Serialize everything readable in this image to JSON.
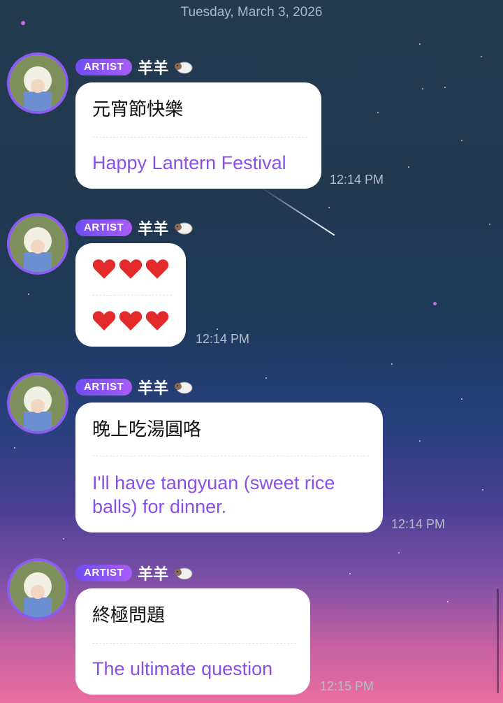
{
  "chat": {
    "date_header": "Tuesday, March 3, 2026"
  },
  "colors": {
    "badge_gradient_start": "#6f4cf1",
    "badge_gradient_end": "#a85cf6",
    "translation_text": "#8a50e6",
    "avatar_ring": "#8a5cf0"
  },
  "messages": [
    {
      "role_badge": "ARTIST",
      "sender_name": "羊羊",
      "sender_icon": "sheep-icon",
      "original_text": "元宵節快樂",
      "translated_text": "Happy Lantern Festival",
      "time": "12:14 PM"
    },
    {
      "role_badge": "ARTIST",
      "sender_name": "羊羊",
      "sender_icon": "sheep-icon",
      "original_icons": [
        "heart-icon",
        "heart-icon",
        "heart-icon"
      ],
      "translated_icons": [
        "heart-icon",
        "heart-icon",
        "heart-icon"
      ],
      "time": "12:14 PM"
    },
    {
      "role_badge": "ARTIST",
      "sender_name": "羊羊",
      "sender_icon": "sheep-icon",
      "original_text": "晚上吃湯圓咯",
      "translated_text": "I'll have tangyuan (sweet rice balls) for dinner.",
      "time": "12:14 PM"
    },
    {
      "role_badge": "ARTIST",
      "sender_name": "羊羊",
      "sender_icon": "sheep-icon",
      "original_text": "終極問題",
      "translated_text": "The ultimate question",
      "time": "12:15 PM"
    }
  ]
}
